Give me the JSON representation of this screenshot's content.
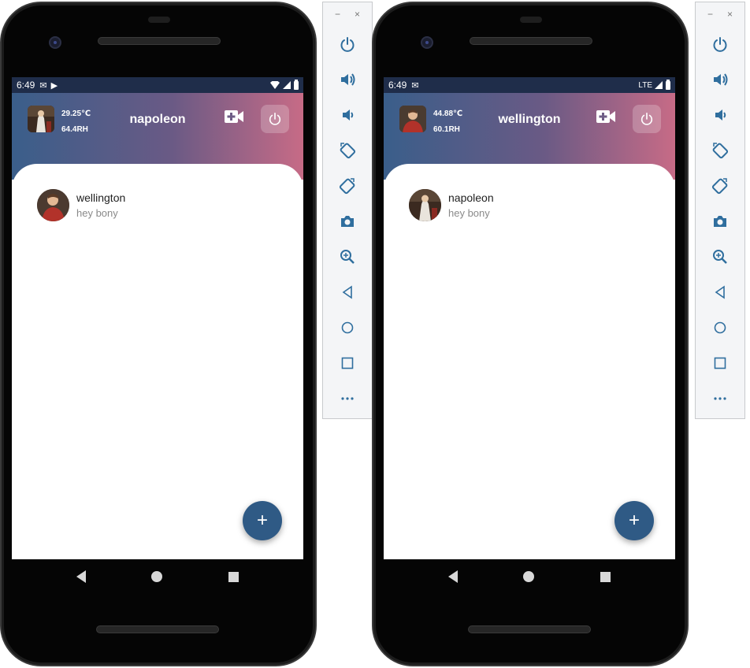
{
  "left_device": {
    "status": {
      "time": "6:49",
      "icons": [
        "mail-icon",
        "play-store-icon",
        "wifi-icon",
        "signal-icon",
        "battery-icon"
      ]
    },
    "appbar": {
      "temperature": "29.25℃",
      "humidity": "64.4RH",
      "title": "napoleon"
    },
    "chat": {
      "name": "wellington",
      "message": "hey bony"
    },
    "fab_label": "+"
  },
  "right_device": {
    "status": {
      "time": "6:49",
      "network": "LTE",
      "icons": [
        "mail-icon",
        "signal-icon",
        "battery-icon"
      ]
    },
    "appbar": {
      "temperature": "44.88℃",
      "humidity": "60.1RH",
      "title": "wellington"
    },
    "chat": {
      "name": "napoleon",
      "message": "hey bony"
    },
    "fab_label": "+"
  },
  "toolbar": {
    "window_controls": [
      "−",
      "×"
    ],
    "items": [
      "power-icon",
      "volume-up-icon",
      "volume-down-icon",
      "rotate-left-icon",
      "rotate-right-icon",
      "camera-icon",
      "zoom-icon",
      "back-icon",
      "home-icon",
      "overview-icon",
      "more-icon"
    ]
  },
  "colors": {
    "appbar_start": "#3a5e8a",
    "appbar_end": "#c76b86",
    "fab": "#2f5a85",
    "statusbar": "#1f2d4a"
  }
}
